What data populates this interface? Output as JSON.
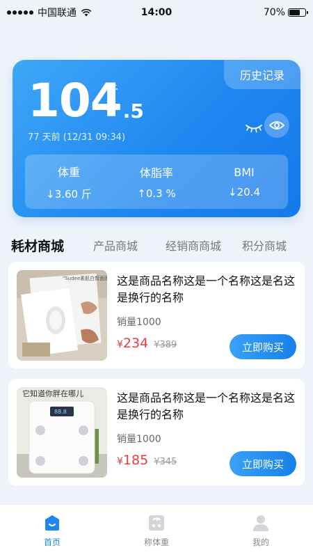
{
  "status_bar": {
    "carrier": "中国联通",
    "time": "14:00",
    "battery_text": "70%",
    "battery_level": 0.7
  },
  "weight": {
    "history_label": "历史记录",
    "integer": "104",
    "decimal": ".5",
    "unit": "斤",
    "time_text": "77 天前 (12/31 09:34)",
    "stats": [
      {
        "label": "体重",
        "value": "↓3.60 斤"
      },
      {
        "label": "体脂率",
        "value": "↑0.3 %"
      },
      {
        "label": "BMI",
        "value": "↓20.4"
      }
    ]
  },
  "tabs": [
    {
      "label": "耗材商城",
      "active": true
    },
    {
      "label": "产品商城",
      "active": false
    },
    {
      "label": "经销商商城",
      "active": false
    },
    {
      "label": "积分商城",
      "active": false
    }
  ],
  "products": [
    {
      "title": "这是商品名称这是一个名称这是名这是换行的名称",
      "sales": "销量1000",
      "price_symbol": "¥",
      "price": "234",
      "old_price": "¥389",
      "buy_label": "立即购买",
      "image_text": "\"Sudee素肌白皙面膜"
    },
    {
      "title": "这是商品名称这是一个名称这是名这是换行的名称",
      "sales": "销量1000",
      "price_symbol": "¥",
      "price": "185",
      "old_price": "¥345",
      "buy_label": "立即购买",
      "image_text": "它知道你胖在哪儿"
    }
  ],
  "bottom_nav": [
    {
      "label": "首页",
      "active": true
    },
    {
      "label": "称体重",
      "active": false
    },
    {
      "label": "我的",
      "active": false
    }
  ],
  "colors": {
    "primary": "#1d86f0",
    "price_red": "#ee3b3b",
    "background": "#eef3f9"
  }
}
